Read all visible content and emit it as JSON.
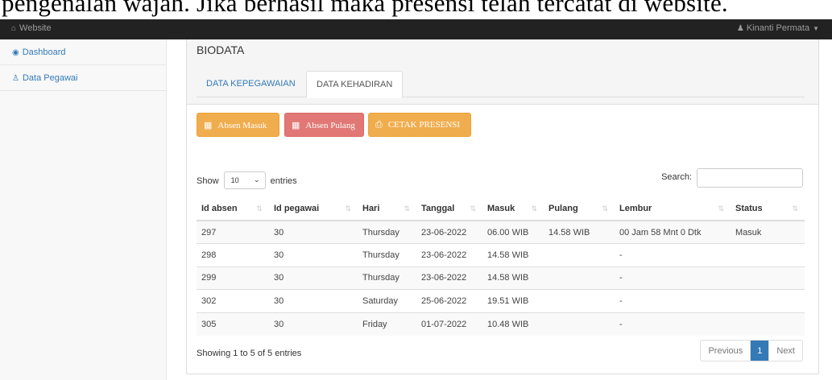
{
  "caption": "pengenalan wajah. Jika berhasil maka presensi telah tercatat di website.",
  "navbar": {
    "brand": "Website",
    "brand_icon": "home-icon",
    "user": "Kinanti Permata",
    "user_icon": "user-icon"
  },
  "sidebar": {
    "items": [
      {
        "label": "Dashboard",
        "icon": "dashboard-icon"
      },
      {
        "label": "Data Pegawai",
        "icon": "users-icon"
      }
    ]
  },
  "main": {
    "title": "BIODATA",
    "tabs": [
      {
        "label": "DATA KEPEGAWAIAN"
      },
      {
        "label": "DATA KEHADIRAN"
      }
    ],
    "buttons": {
      "absen_masuk": "Absen Masuk",
      "absen_pulang": "Absen Pulang",
      "cetak": "CETAK PRESENSI"
    },
    "length": {
      "show": "Show",
      "value": "10",
      "entries": "entries"
    },
    "search": {
      "label": "Search:",
      "value": ""
    },
    "table": {
      "headers": [
        "Id absen",
        "Id pegawai",
        "Hari",
        "Tanggal",
        "Masuk",
        "Pulang",
        "Lembur",
        "Status"
      ],
      "rows": [
        [
          "297",
          "30",
          "Thursday",
          "23-06-2022",
          "06.00 WIB",
          "14.58 WIB",
          "00 Jam 58 Mnt 0 Dtk",
          "Masuk"
        ],
        [
          "298",
          "30",
          "Thursday",
          "23-06-2022",
          "14.58 WIB",
          "",
          "-",
          ""
        ],
        [
          "299",
          "30",
          "Thursday",
          "23-06-2022",
          "14.58 WIB",
          "",
          "-",
          ""
        ],
        [
          "302",
          "30",
          "Saturday",
          "25-06-2022",
          "19.51 WIB",
          "",
          "-",
          ""
        ],
        [
          "305",
          "30",
          "Friday",
          "01-07-2022",
          "10.48 WIB",
          "",
          "-",
          ""
        ]
      ]
    },
    "info": "Showing 1 to 5 of 5 entries",
    "pagination": {
      "previous": "Previous",
      "current": "1",
      "next": "Next"
    }
  },
  "colors": {
    "navbar": "#222222",
    "link": "#337ab7",
    "warning": "#f0ad4e",
    "danger": "#d9534f",
    "active_page": "#337ab7"
  }
}
